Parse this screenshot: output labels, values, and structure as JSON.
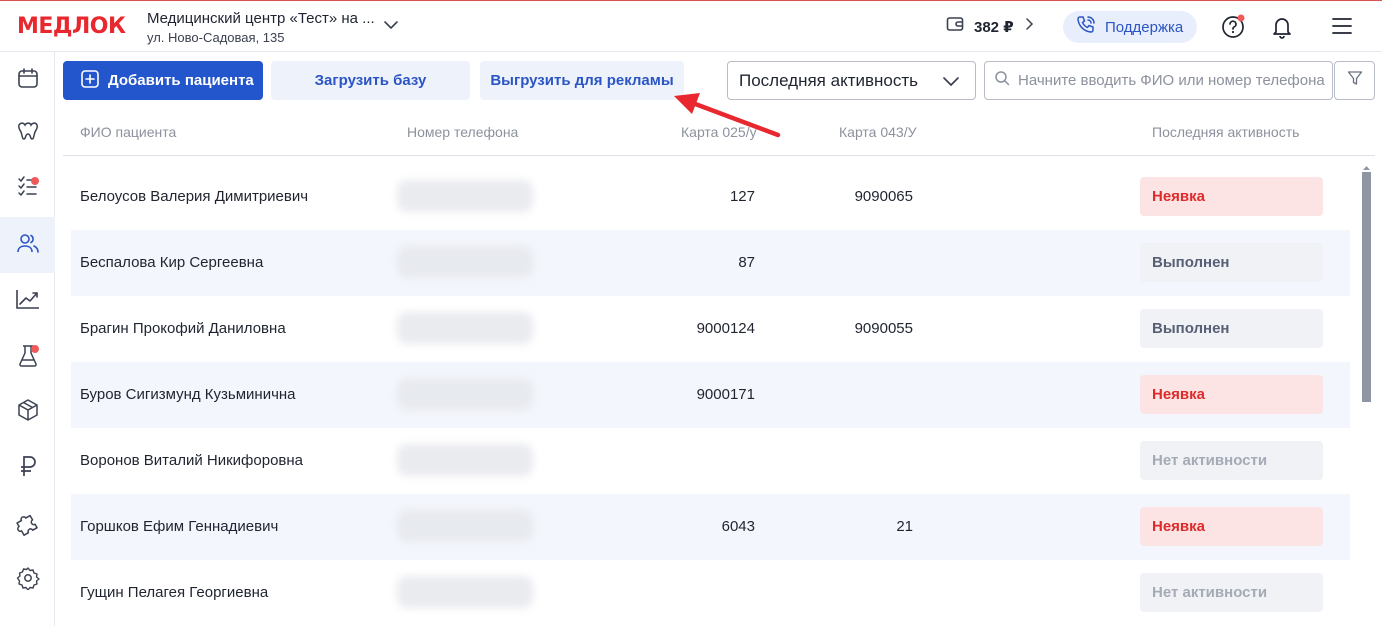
{
  "header": {
    "logo": "МЕДЛОК",
    "clinic_name": "Медицинский центр «Тест» на ...",
    "clinic_address": "ул. Ново-Садовая, 135",
    "balance": "382 ₽",
    "support_label": "Поддержка"
  },
  "sidebar": {
    "items": [
      {
        "icon": "calendar-icon"
      },
      {
        "icon": "tooth-icon"
      },
      {
        "icon": "checklist-icon",
        "badge": true
      },
      {
        "icon": "patients-icon",
        "active": true
      },
      {
        "icon": "analytics-icon"
      },
      {
        "icon": "lab-flask-icon",
        "badge": true
      },
      {
        "icon": "box-icon"
      },
      {
        "icon": "ruble-icon"
      },
      {
        "icon": "puzzle-icon"
      },
      {
        "icon": "gear-icon"
      }
    ]
  },
  "toolbar": {
    "add_patient_label": "Добавить пациента",
    "upload_base_label": "Загрузить базу",
    "export_ads_label": "Выгрузить для рекламы",
    "sort_select_value": "Последняя активность",
    "search_placeholder": "Начните вводить ФИО или номер телефона"
  },
  "table": {
    "columns": [
      "ФИО пациента",
      "Номер телефона",
      "Карта 025/у",
      "Карта 043/У",
      "Последняя активность"
    ],
    "rows": [
      {
        "name": "Белоусов Валерия Димитриевич",
        "card025": "127",
        "card043": "9090065",
        "status": "Неявка",
        "status_type": "noshow"
      },
      {
        "name": "Беспалова Кир Сергеевна",
        "card025": "87",
        "card043": "",
        "status": "Выполнен",
        "status_type": "done"
      },
      {
        "name": "Брагин Прокофий Даниловна",
        "card025": "9000124",
        "card043": "9090055",
        "status": "Выполнен",
        "status_type": "done"
      },
      {
        "name": "Буров Сигизмунд Кузьминична",
        "card025": "9000171",
        "card043": "",
        "status": "Неявка",
        "status_type": "noshow"
      },
      {
        "name": "Воронов Виталий Никифоровна",
        "card025": "",
        "card043": "",
        "status": "Нет активности",
        "status_type": "none"
      },
      {
        "name": "Горшков Ефим Геннадиевич",
        "card025": "6043",
        "card043": "21",
        "status": "Неявка",
        "status_type": "noshow"
      },
      {
        "name": "Гущин Пелагея Георгиевна",
        "card025": "",
        "card043": "",
        "status": "Нет активности",
        "status_type": "none"
      }
    ]
  },
  "colors": {
    "brand": "#e8282e",
    "primary": "#2356cc",
    "noshow": "#dd2b2b",
    "annotation_arrow": "#e8282e"
  }
}
